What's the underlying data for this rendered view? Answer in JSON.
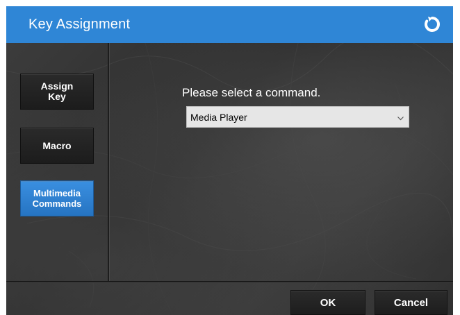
{
  "dialog": {
    "title": "Key Assignment",
    "reset_icon": "refresh-icon"
  },
  "sidebar": {
    "items": [
      {
        "label_line1": "Assign",
        "label_line2": "Key",
        "active": false
      },
      {
        "label": "Macro",
        "active": false
      },
      {
        "label_line1": "Multimedia",
        "label_line2": "Commands",
        "active": true
      }
    ]
  },
  "main": {
    "prompt": "Please select a command.",
    "command_select": {
      "value": "Media Player",
      "arrow_icon": "chevron-down-icon"
    }
  },
  "footer": {
    "ok_label": "OK",
    "cancel_label": "Cancel"
  },
  "colors": {
    "accent": "#2f86d6",
    "background": "#2f2f2f",
    "button_dark": "#1d1d1d"
  }
}
